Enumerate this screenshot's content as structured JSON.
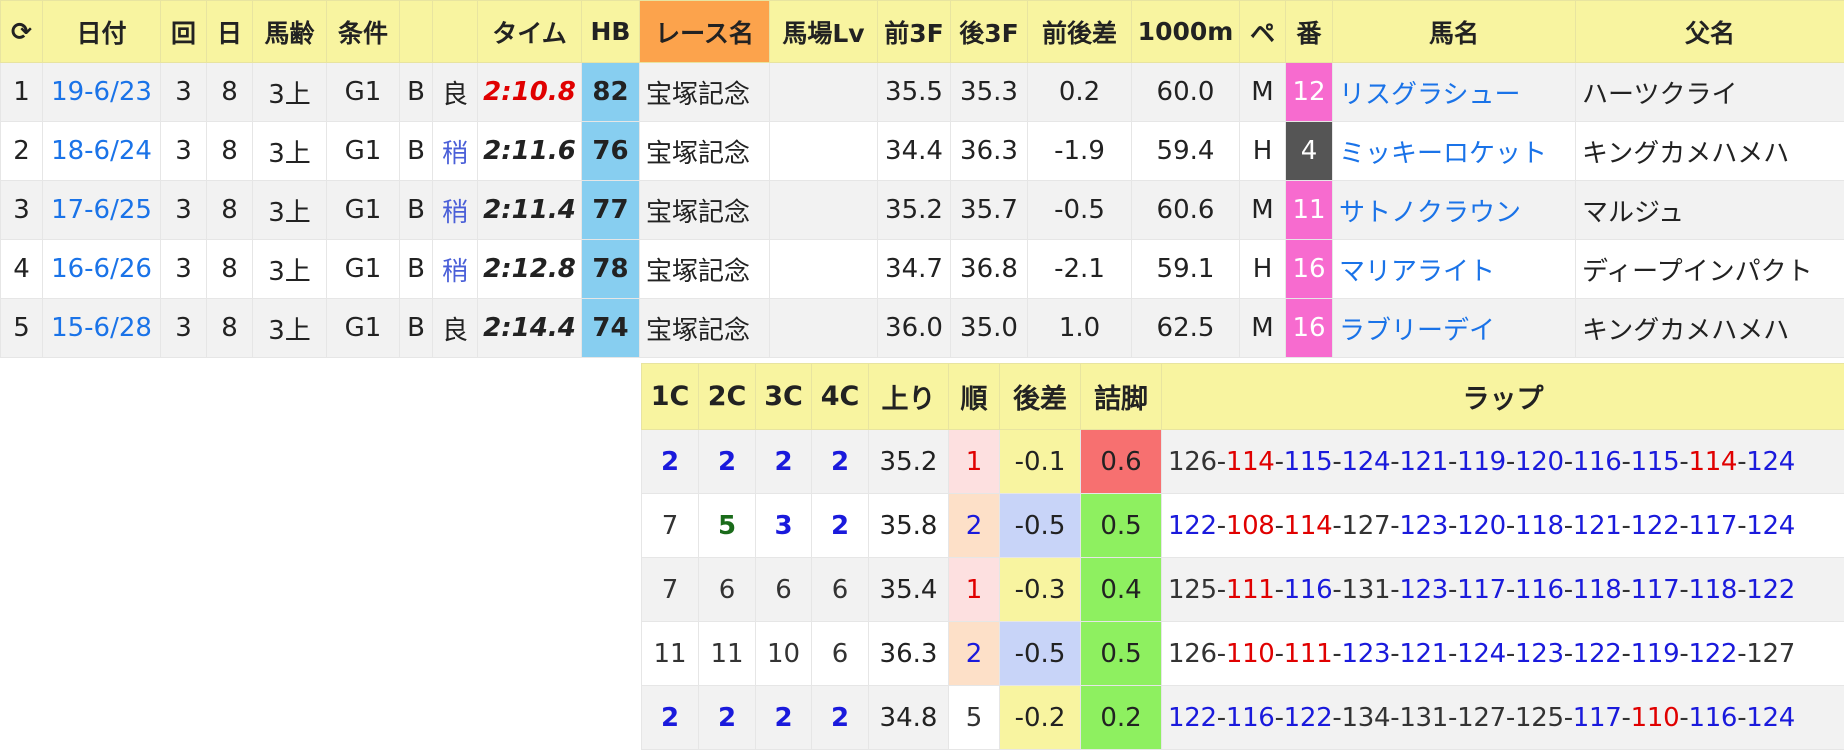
{
  "main_headers": [
    "⟳",
    "日付",
    "回",
    "日",
    "馬齢",
    "条件",
    "",
    "",
    "タイム",
    "HB",
    "レース名",
    "馬場Lv",
    "前3F",
    "後3F",
    "前後差",
    "1000m",
    "ペ",
    "番",
    "馬名",
    "父名"
  ],
  "rows": [
    {
      "idx": "1",
      "date": "19-6/23",
      "kai": "3",
      "nichi": "8",
      "age": "3上",
      "cond": "G1",
      "b": "B",
      "track": "良",
      "track_type": "good",
      "time": "2:10.8",
      "time_best": true,
      "hb": "82",
      "race": "宝塚記念",
      "lv": "",
      "f3": "35.5",
      "l3": "35.3",
      "diff": "0.2",
      "m1000": "60.0",
      "pace": "M",
      "no": "12",
      "no_color": "#f76bcf",
      "horse": "リスグラシュー",
      "sire": "ハーツクライ"
    },
    {
      "idx": "2",
      "date": "18-6/24",
      "kai": "3",
      "nichi": "8",
      "age": "3上",
      "cond": "G1",
      "b": "B",
      "track": "稍",
      "track_type": "yaya",
      "time": "2:11.6",
      "time_best": false,
      "hb": "76",
      "race": "宝塚記念",
      "lv": "",
      "f3": "34.4",
      "l3": "36.3",
      "diff": "-1.9",
      "m1000": "59.4",
      "pace": "H",
      "no": "4",
      "no_color": "#555555",
      "horse": "ミッキーロケット",
      "sire": "キングカメハメハ"
    },
    {
      "idx": "3",
      "date": "17-6/25",
      "kai": "3",
      "nichi": "8",
      "age": "3上",
      "cond": "G1",
      "b": "B",
      "track": "稍",
      "track_type": "yaya",
      "time": "2:11.4",
      "time_best": false,
      "hb": "77",
      "race": "宝塚記念",
      "lv": "",
      "f3": "35.2",
      "l3": "35.7",
      "diff": "-0.5",
      "m1000": "60.6",
      "pace": "M",
      "no": "11",
      "no_color": "#f76bcf",
      "horse": "サトノクラウン",
      "sire": "マルジュ"
    },
    {
      "idx": "4",
      "date": "16-6/26",
      "kai": "3",
      "nichi": "8",
      "age": "3上",
      "cond": "G1",
      "b": "B",
      "track": "稍",
      "track_type": "yaya",
      "time": "2:12.8",
      "time_best": false,
      "hb": "78",
      "race": "宝塚記念",
      "lv": "",
      "f3": "34.7",
      "l3": "36.8",
      "diff": "-2.1",
      "m1000": "59.1",
      "pace": "H",
      "no": "16",
      "no_color": "#f76bcf",
      "horse": "マリアライト",
      "sire": "ディープインパクト"
    },
    {
      "idx": "5",
      "date": "15-6/28",
      "kai": "3",
      "nichi": "8",
      "age": "3上",
      "cond": "G1",
      "b": "B",
      "track": "良",
      "track_type": "good",
      "time": "2:14.4",
      "time_best": false,
      "hb": "74",
      "race": "宝塚記念",
      "lv": "",
      "f3": "36.0",
      "l3": "35.0",
      "diff": "1.0",
      "m1000": "62.5",
      "pace": "M",
      "no": "16",
      "no_color": "#f76bcf",
      "horse": "ラブリーデイ",
      "sire": "キングカメハメハ"
    }
  ],
  "sub_headers": [
    "1C",
    "2C",
    "3C",
    "4C",
    "上り",
    "順",
    "後差",
    "詰脚",
    "ラップ"
  ],
  "sub_rows": [
    {
      "c1": {
        "v": "2",
        "c": "blue",
        "b": true
      },
      "c2": {
        "v": "2",
        "c": "blue",
        "b": true
      },
      "c3": {
        "v": "2",
        "c": "blue",
        "b": true
      },
      "c4": {
        "v": "2",
        "c": "blue",
        "b": true
      },
      "agari": "35.2",
      "jun": "1",
      "jun_bg": "#fde0e0",
      "jun_c": "#e00000",
      "gosa": "-0.1",
      "gosa_bg": "#f8f4a0",
      "tsume": "0.6",
      "tsume_bg": "#f77070",
      "lap": [
        {
          "v": "126",
          "c": "dark"
        },
        {
          "v": "114",
          "c": "red"
        },
        {
          "v": "115",
          "c": "blue"
        },
        {
          "v": "124",
          "c": "blue"
        },
        {
          "v": "121",
          "c": "blue"
        },
        {
          "v": "119",
          "c": "blue"
        },
        {
          "v": "120",
          "c": "blue"
        },
        {
          "v": "116",
          "c": "blue"
        },
        {
          "v": "115",
          "c": "blue"
        },
        {
          "v": "114",
          "c": "red"
        },
        {
          "v": "124",
          "c": "blue"
        }
      ]
    },
    {
      "c1": {
        "v": "7",
        "c": "dark",
        "b": false
      },
      "c2": {
        "v": "5",
        "c": "green",
        "b": true
      },
      "c3": {
        "v": "3",
        "c": "blue",
        "b": true
      },
      "c4": {
        "v": "2",
        "c": "blue",
        "b": true
      },
      "agari": "35.8",
      "jun": "2",
      "jun_bg": "#fde0c8",
      "jun_c": "#1a1adc",
      "gosa": "-0.5",
      "gosa_bg": "#c8d4f8",
      "tsume": "0.5",
      "tsume_bg": "#8ef060",
      "lap": [
        {
          "v": "122",
          "c": "blue"
        },
        {
          "v": "108",
          "c": "red"
        },
        {
          "v": "114",
          "c": "red"
        },
        {
          "v": "127",
          "c": "dark"
        },
        {
          "v": "123",
          "c": "blue"
        },
        {
          "v": "120",
          "c": "blue"
        },
        {
          "v": "118",
          "c": "blue"
        },
        {
          "v": "121",
          "c": "blue"
        },
        {
          "v": "122",
          "c": "blue"
        },
        {
          "v": "117",
          "c": "blue"
        },
        {
          "v": "124",
          "c": "blue"
        }
      ]
    },
    {
      "c1": {
        "v": "7",
        "c": "dark",
        "b": false
      },
      "c2": {
        "v": "6",
        "c": "dark",
        "b": false
      },
      "c3": {
        "v": "6",
        "c": "dark",
        "b": false
      },
      "c4": {
        "v": "6",
        "c": "dark",
        "b": false
      },
      "agari": "35.4",
      "jun": "1",
      "jun_bg": "#fde0e0",
      "jun_c": "#e00000",
      "gosa": "-0.3",
      "gosa_bg": "#f8f4a0",
      "tsume": "0.4",
      "tsume_bg": "#8ef060",
      "lap": [
        {
          "v": "125",
          "c": "dark"
        },
        {
          "v": "111",
          "c": "red"
        },
        {
          "v": "116",
          "c": "blue"
        },
        {
          "v": "131",
          "c": "dark"
        },
        {
          "v": "123",
          "c": "blue"
        },
        {
          "v": "117",
          "c": "blue"
        },
        {
          "v": "116",
          "c": "blue"
        },
        {
          "v": "118",
          "c": "blue"
        },
        {
          "v": "117",
          "c": "blue"
        },
        {
          "v": "118",
          "c": "blue"
        },
        {
          "v": "122",
          "c": "blue"
        }
      ]
    },
    {
      "c1": {
        "v": "11",
        "c": "dark",
        "b": false
      },
      "c2": {
        "v": "11",
        "c": "dark",
        "b": false
      },
      "c3": {
        "v": "10",
        "c": "dark",
        "b": false
      },
      "c4": {
        "v": "6",
        "c": "dark",
        "b": false
      },
      "agari": "36.3",
      "jun": "2",
      "jun_bg": "#fde0c8",
      "jun_c": "#1a1adc",
      "gosa": "-0.5",
      "gosa_bg": "#c8d4f8",
      "tsume": "0.5",
      "tsume_bg": "#8ef060",
      "lap": [
        {
          "v": "126",
          "c": "dark"
        },
        {
          "v": "110",
          "c": "red"
        },
        {
          "v": "111",
          "c": "red"
        },
        {
          "v": "123",
          "c": "blue"
        },
        {
          "v": "121",
          "c": "blue"
        },
        {
          "v": "124",
          "c": "blue"
        },
        {
          "v": "123",
          "c": "blue"
        },
        {
          "v": "122",
          "c": "blue"
        },
        {
          "v": "119",
          "c": "blue"
        },
        {
          "v": "122",
          "c": "blue"
        },
        {
          "v": "127",
          "c": "dark"
        }
      ]
    },
    {
      "c1": {
        "v": "2",
        "c": "blue",
        "b": true
      },
      "c2": {
        "v": "2",
        "c": "blue",
        "b": true
      },
      "c3": {
        "v": "2",
        "c": "blue",
        "b": true
      },
      "c4": {
        "v": "2",
        "c": "blue",
        "b": true
      },
      "agari": "34.8",
      "jun": "5",
      "jun_bg": "#ffffff",
      "jun_c": "#333333",
      "gosa": "-0.2",
      "gosa_bg": "#f8f4a0",
      "tsume": "0.2",
      "tsume_bg": "#8ef060",
      "lap": [
        {
          "v": "122",
          "c": "blue"
        },
        {
          "v": "116",
          "c": "blue"
        },
        {
          "v": "122",
          "c": "blue"
        },
        {
          "v": "134",
          "c": "dark"
        },
        {
          "v": "131",
          "c": "dark"
        },
        {
          "v": "127",
          "c": "dark"
        },
        {
          "v": "125",
          "c": "dark"
        },
        {
          "v": "117",
          "c": "blue"
        },
        {
          "v": "110",
          "c": "red"
        },
        {
          "v": "116",
          "c": "blue"
        },
        {
          "v": "124",
          "c": "blue"
        }
      ]
    }
  ]
}
